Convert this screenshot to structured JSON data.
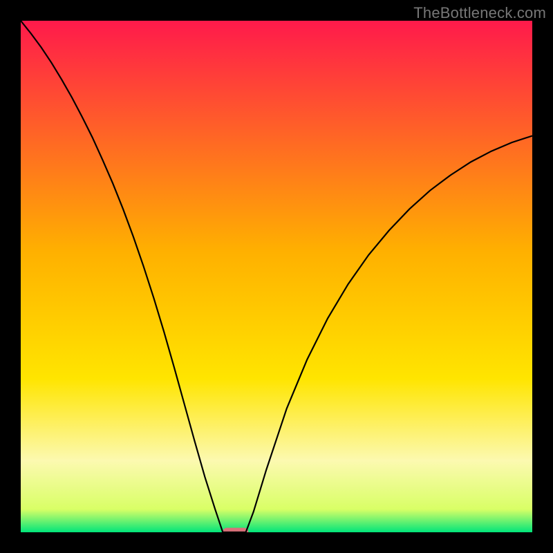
{
  "watermark": {
    "text": "TheBottleneck.com"
  },
  "chart_data": {
    "type": "line",
    "title": "",
    "xlabel": "",
    "ylabel": "",
    "xlim": [
      0,
      100
    ],
    "ylim": [
      0,
      100
    ],
    "background_gradient": {
      "stops": [
        {
          "offset": 0.0,
          "color": "#ff1a4b"
        },
        {
          "offset": 0.45,
          "color": "#ffb000"
        },
        {
          "offset": 0.7,
          "color": "#ffe500"
        },
        {
          "offset": 0.86,
          "color": "#fcf9b0"
        },
        {
          "offset": 0.955,
          "color": "#d9ff66"
        },
        {
          "offset": 1.0,
          "color": "#00e57a"
        }
      ]
    },
    "curve": {
      "x": [
        0,
        2,
        4,
        6,
        8,
        10,
        12,
        14,
        16,
        18,
        20,
        22,
        24,
        26,
        28,
        30,
        32,
        34,
        36,
        38,
        39.5,
        41,
        44,
        45.5,
        48,
        52,
        56,
        60,
        64,
        68,
        72,
        76,
        80,
        84,
        88,
        92,
        96,
        100
      ],
      "y": [
        100,
        97.5,
        94.8,
        91.8,
        88.5,
        85,
        81.2,
        77.2,
        72.8,
        68.2,
        63.2,
        57.8,
        52,
        45.8,
        39.2,
        32.2,
        25,
        17.8,
        10.8,
        4.5,
        0,
        0,
        0,
        4,
        12.2,
        24.2,
        33.8,
        41.8,
        48.5,
        54.2,
        59,
        63.2,
        66.8,
        69.8,
        72.4,
        74.5,
        76.2,
        77.5
      ]
    },
    "marker": {
      "x_center": 42.0,
      "y": 0,
      "width": 5.0,
      "color": "#d9707a"
    }
  }
}
